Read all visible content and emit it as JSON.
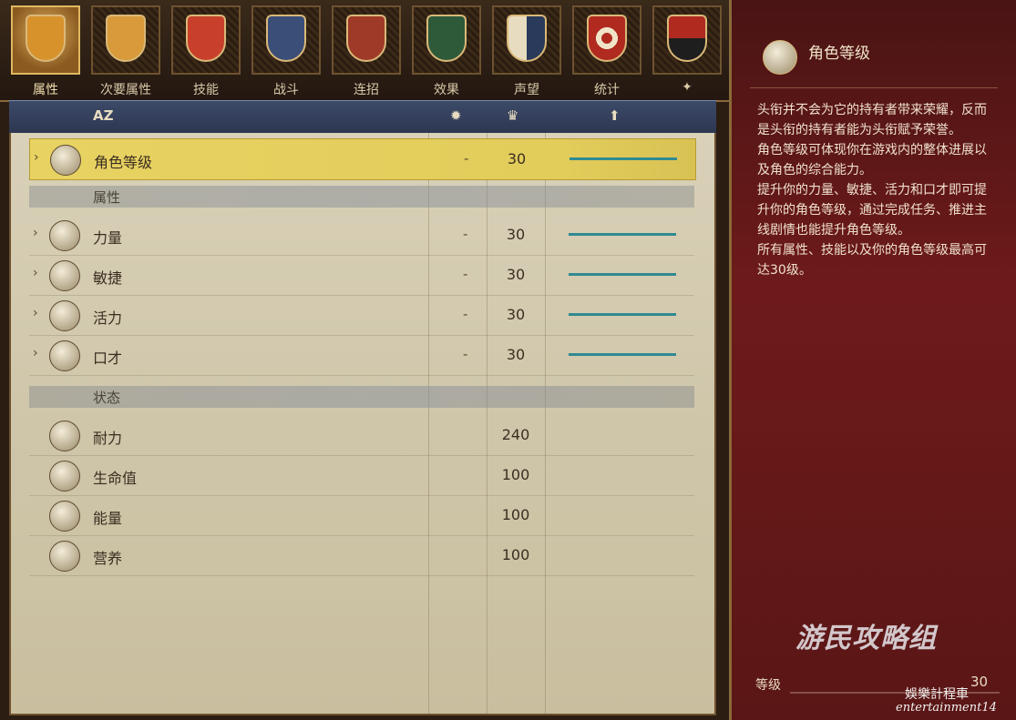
{
  "tabs": [
    {
      "label": "属性",
      "icon": "lion-shield-icon",
      "active": true
    },
    {
      "label": "次要属性",
      "icon": "cross-shield-icon",
      "active": false
    },
    {
      "label": "技能",
      "icon": "hand-shield-icon",
      "active": false
    },
    {
      "label": "战斗",
      "icon": "sword-shield-icon",
      "active": false
    },
    {
      "label": "连招",
      "icon": "arms-shield-icon",
      "active": false
    },
    {
      "label": "效果",
      "icon": "fist-shield-icon",
      "active": false
    },
    {
      "label": "声望",
      "icon": "banner-shield-icon",
      "active": false
    },
    {
      "label": "统计",
      "icon": "target-shield-icon",
      "active": false
    },
    {
      "label": "✦",
      "icon": "beast-shield-icon",
      "active": false
    }
  ],
  "header": {
    "sort": "AZ",
    "col1_icon": "gear-icon",
    "col2_icon": "crown-icon",
    "col3_icon": "up-arrow-icon"
  },
  "rows": [
    {
      "name": "角色等级",
      "dash": "-",
      "value": "30",
      "icon": "level-orb-icon",
      "bar": 1.0,
      "selected": true
    },
    {
      "section": "属性"
    },
    {
      "name": "力量",
      "dash": "-",
      "value": "30",
      "icon": "strength-icon",
      "bar": 1.0
    },
    {
      "name": "敏捷",
      "dash": "-",
      "value": "30",
      "icon": "agility-icon",
      "bar": 1.0
    },
    {
      "name": "活力",
      "dash": "-",
      "value": "30",
      "icon": "vitality-icon",
      "bar": 1.0
    },
    {
      "name": "口才",
      "dash": "-",
      "value": "30",
      "icon": "speech-icon",
      "bar": 1.0
    },
    {
      "section": "状态"
    },
    {
      "name": "耐力",
      "value": "240",
      "icon": "stamina-icon"
    },
    {
      "name": "生命值",
      "value": "100",
      "icon": "health-icon"
    },
    {
      "name": "能量",
      "value": "100",
      "icon": "energy-icon"
    },
    {
      "name": "营养",
      "value": "100",
      "icon": "nutrition-icon"
    }
  ],
  "info": {
    "title": "角色等级",
    "description": "头衔并不会为它的持有者带来荣耀，反而是头衔的持有者能为头衔赋予荣誉。\n角色等级可体现你在游戏内的整体进展以及角色的综合能力。\n提升你的力量、敏捷、活力和口才即可提升你的角色等级，通过完成任务、推进主线剧情也能提升角色等级。\n所有属性、技能以及你的角色等级最高可达30级。",
    "level_label": "等级",
    "level_value": "30",
    "watermark": "游民攻略组",
    "watermark2": "娛樂計程車",
    "watermark3": "entertainment14"
  }
}
